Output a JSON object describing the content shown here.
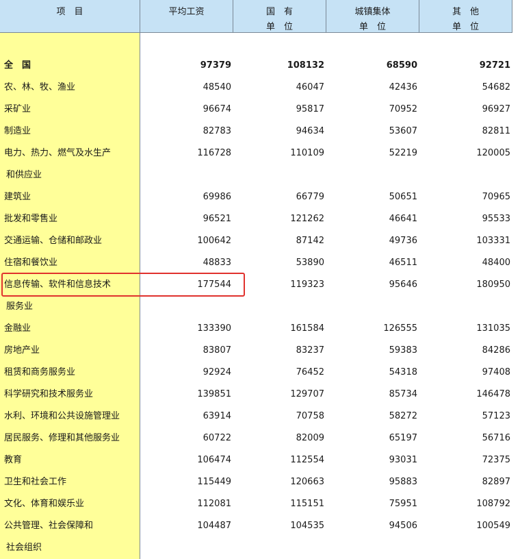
{
  "header": {
    "item": "项　目",
    "avg_wage": "平均工资",
    "state_owned": [
      "国　有",
      "单　位"
    ],
    "urban_collective": [
      "城镇集体",
      "单　位"
    ],
    "other": [
      "其　他",
      "单　位"
    ]
  },
  "rows": [
    {
      "label": "全　国",
      "bold": true,
      "values": [
        "97379",
        "108132",
        "68590",
        "92721"
      ]
    },
    {
      "label": "农、林、牧、渔业",
      "values": [
        "48540",
        "46047",
        "42436",
        "54682"
      ]
    },
    {
      "label": "采矿业",
      "values": [
        "96674",
        "95817",
        "70952",
        "96927"
      ]
    },
    {
      "label": "制造业",
      "values": [
        "82783",
        "94634",
        "53607",
        "82811"
      ]
    },
    {
      "label": "电力、热力、燃气及水生产",
      "values": [
        "116728",
        "110109",
        "52219",
        "120005"
      ]
    },
    {
      "label": "和供应业",
      "continuation": true,
      "values": [
        "",
        "",
        "",
        ""
      ]
    },
    {
      "label": "建筑业",
      "values": [
        "69986",
        "66779",
        "50651",
        "70965"
      ]
    },
    {
      "label": "批发和零售业",
      "values": [
        "96521",
        "121262",
        "46641",
        "95533"
      ]
    },
    {
      "label": "交通运输、仓储和邮政业",
      "values": [
        "100642",
        "87142",
        "49736",
        "103331"
      ]
    },
    {
      "label": "住宿和餐饮业",
      "values": [
        "48833",
        "53890",
        "46511",
        "48400"
      ]
    },
    {
      "label": "信息传输、软件和信息技术",
      "highlight": true,
      "values": [
        "177544",
        "119323",
        "95646",
        "180950"
      ]
    },
    {
      "label": "服务业",
      "continuation": true,
      "values": [
        "",
        "",
        "",
        ""
      ]
    },
    {
      "label": "金融业",
      "values": [
        "133390",
        "161584",
        "126555",
        "131035"
      ]
    },
    {
      "label": "房地产业",
      "values": [
        "83807",
        "83237",
        "59383",
        "84286"
      ]
    },
    {
      "label": "租赁和商务服务业",
      "values": [
        "92924",
        "76452",
        "54318",
        "97408"
      ]
    },
    {
      "label": "科学研究和技术服务业",
      "values": [
        "139851",
        "129707",
        "85734",
        "146478"
      ]
    },
    {
      "label": "水利、环境和公共设施管理业",
      "values": [
        "63914",
        "70758",
        "58272",
        "57123"
      ]
    },
    {
      "label": "居民服务、修理和其他服务业",
      "values": [
        "60722",
        "82009",
        "65197",
        "56716"
      ]
    },
    {
      "label": "教育",
      "values": [
        "106474",
        "112554",
        "93031",
        "72375"
      ]
    },
    {
      "label": "卫生和社会工作",
      "values": [
        "115449",
        "120663",
        "95883",
        "82897"
      ]
    },
    {
      "label": "文化、体育和娱乐业",
      "values": [
        "112081",
        "115151",
        "75951",
        "108792"
      ]
    },
    {
      "label": "公共管理、社会保障和",
      "values": [
        "104487",
        "104535",
        "94506",
        "100549"
      ]
    },
    {
      "label": "社会组织",
      "continuation": true,
      "values": [
        "",
        "",
        "",
        ""
      ]
    }
  ],
  "colors": {
    "header_bg": "#c6e2f5",
    "first_column_bg": "#ffff99",
    "highlight_border": "#e0312d"
  }
}
